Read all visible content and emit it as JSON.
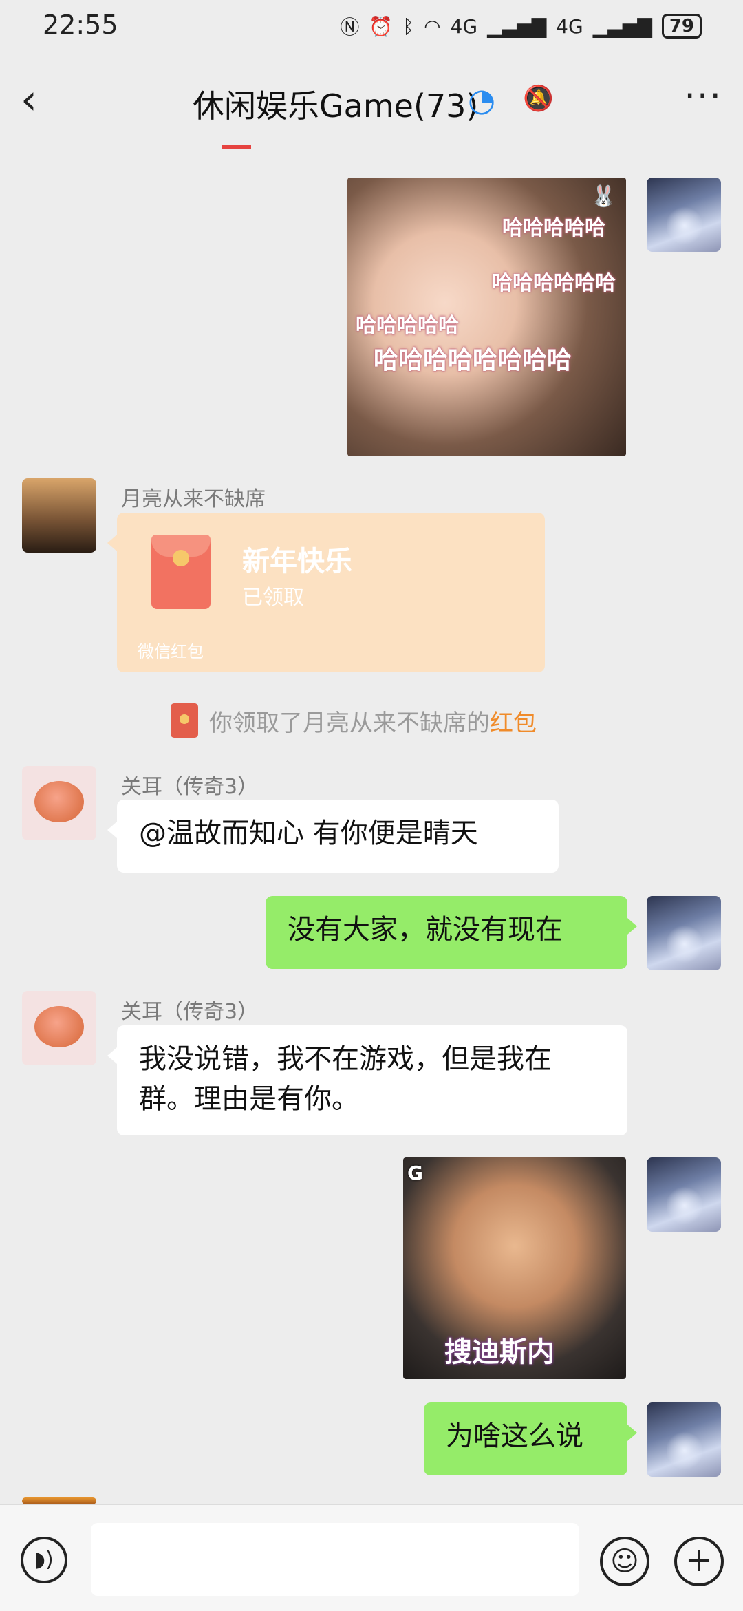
{
  "status": {
    "time": "22:55",
    "signal1": "4G",
    "signal2": "4G",
    "battery": "79"
  },
  "header": {
    "title": "休闲娱乐Game(73)"
  },
  "messages": {
    "sticker1": {
      "lines": [
        "哈哈哈哈哈",
        "哈哈哈哈哈哈",
        "哈哈哈哈哈",
        "哈哈哈哈哈哈哈哈"
      ]
    },
    "redpacket_sender": "月亮从来不缺席",
    "redpacket": {
      "title": "新年快乐",
      "status": "已领取",
      "footer": "微信红包"
    },
    "system": {
      "text": "你领取了月亮从来不缺席的",
      "link": "红包"
    },
    "msg1_sender": "关耳（传奇3）",
    "msg1": "@温故而知心  有你便是晴天",
    "msg2": "没有大家，就没有现在",
    "msg3_sender": "关耳（传奇3）",
    "msg3_line1": "我没说错，我不在游戏，但是我在",
    "msg3_line2": "群。理由是有你。",
    "sticker2": {
      "caption": "搜迪斯内"
    },
    "msg4": "为啥这么说"
  },
  "input": {
    "placeholder": ""
  }
}
